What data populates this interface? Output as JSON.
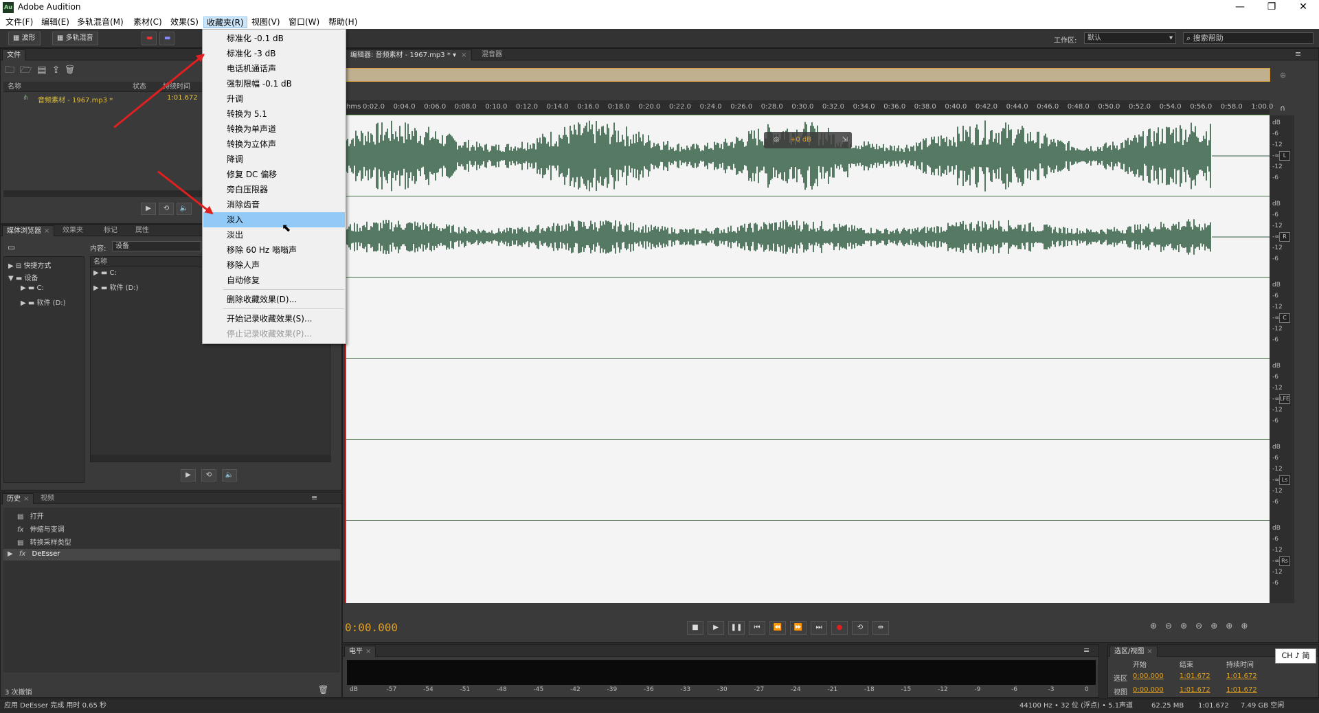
{
  "window": {
    "title": "Adobe Audition",
    "logo": "Au",
    "minimize": "—",
    "restore": "❐",
    "close": "✕"
  },
  "menubar": [
    "文件(F)",
    "编辑(E)",
    "多轨混音(M)",
    "素材(C)",
    "效果(S)",
    "收藏夹(R)",
    "视图(V)",
    "窗口(W)",
    "帮助(H)"
  ],
  "toolbar": {
    "waveform": "波形",
    "multitrack": "多轨混音",
    "workspace_label": "工作区:",
    "workspace_value": "默认",
    "search_placeholder": "搜索帮助"
  },
  "files_panel": {
    "tab": "文件",
    "columns": [
      "名称",
      "状态",
      "持续时间"
    ],
    "rows": [
      {
        "name": "音频素材 - 1967.mp3 *",
        "duration": "1:01.672"
      }
    ]
  },
  "media_panel": {
    "tabs": [
      "媒体浏览器",
      "效果夹",
      "标记",
      "属性"
    ],
    "content_label": "内容:",
    "content_value": "设备",
    "tree": [
      "快捷方式",
      "设备",
      "C:",
      "软件 (D:)"
    ],
    "name_col": "名称",
    "list": [
      "C:",
      "软件 (D:)"
    ]
  },
  "history_panel": {
    "tabs": [
      "历史",
      "视频"
    ],
    "items": [
      "打开",
      "伸缩与变调",
      "转换采样类型",
      "DeEsser"
    ],
    "undo_count": "3 次撤销"
  },
  "editor": {
    "tab": "编辑器: 音频素材 - 1967.mp3 *",
    "mixer_tab": "混音器",
    "time_display": "0:00.000",
    "hud_gain": "+0 dB",
    "ruler_ticks": [
      "hms",
      "0:02.0",
      "0:04.0",
      "0:06.0",
      "0:08.0",
      "0:10.0",
      "0:12.0",
      "0:14.0",
      "0:16.0",
      "0:18.0",
      "0:20.0",
      "0:22.0",
      "0:24.0",
      "0:26.0",
      "0:28.0",
      "0:30.0",
      "0:32.0",
      "0:34.0",
      "0:36.0",
      "0:38.0",
      "0:40.0",
      "0:42.0",
      "0:44.0",
      "0:46.0",
      "0:48.0",
      "0:50.0",
      "0:52.0",
      "0:54.0",
      "0:56.0",
      "0:58.0",
      "1:00.0"
    ],
    "channels": [
      "L",
      "R",
      "C",
      "LFE",
      "Ls",
      "Rs"
    ],
    "db_scale": [
      "dB",
      "-6",
      "-12",
      "-∞",
      "-12",
      "-6"
    ]
  },
  "favorites_menu": {
    "items": [
      "标准化 -0.1 dB",
      "标准化 -3 dB",
      "电话机通话声",
      "强制限幅 -0.1 dB",
      "升调",
      "转换为 5.1",
      "转换为单声道",
      "转换为立体声",
      "降调",
      "修复 DC 偏移",
      "旁白压限器",
      "消除齿音",
      "淡入",
      "淡出",
      "移除 60 Hz 嗡嗡声",
      "移除人声",
      "自动修复"
    ],
    "highlighted": "淡入",
    "delete_item": "删除收藏效果(D)...",
    "record_start": "开始记录收藏效果(S)...",
    "record_stop": "停止记录收藏效果(P)..."
  },
  "levels_panel": {
    "tab": "电平",
    "scale": [
      "dB",
      "-57",
      "-54",
      "-51",
      "-48",
      "-45",
      "-42",
      "-39",
      "-36",
      "-33",
      "-30",
      "-27",
      "-24",
      "-21",
      "-18",
      "-15",
      "-12",
      "-9",
      "-6",
      "-3",
      "0"
    ]
  },
  "selection_panel": {
    "tab": "选区/视图",
    "headers": [
      "开始",
      "结束",
      "持续时间"
    ],
    "selection": {
      "label": "选区",
      "start": "0:00.000",
      "end": "1:01.672",
      "duration": "1:01.672"
    },
    "view": {
      "label": "视图",
      "start": "0:00.000",
      "end": "1:01.672",
      "duration": "1:01.672"
    }
  },
  "ime": "CH ♪ 简",
  "status": {
    "left": "应用 DeEsser 完成 用时 0.65 秒",
    "sample": "44100 Hz • 32 位 (浮点) • 5.1声道",
    "size": "62.25 MB",
    "duration": "1:01.672",
    "free": "7.49 GB 空闲"
  },
  "colors": {
    "waveform": "#2e5a3e",
    "accent": "#e0a020",
    "menu_highlight": "#91c9f7"
  }
}
